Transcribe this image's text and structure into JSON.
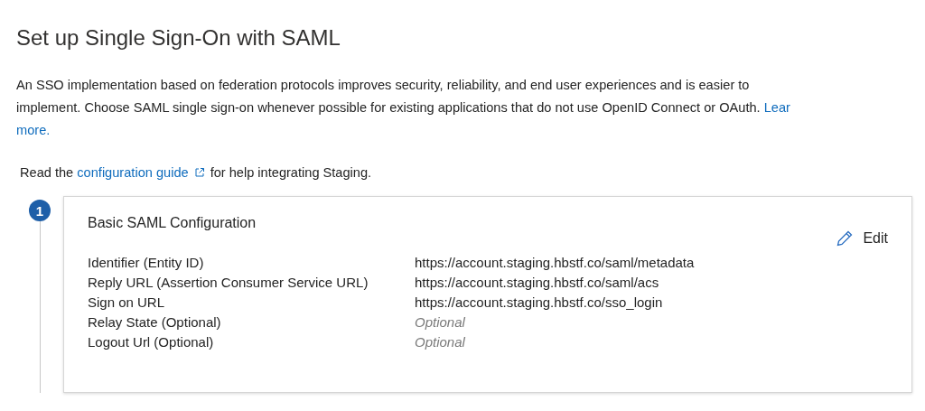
{
  "title": "Set up Single Sign-On with SAML",
  "description": {
    "lines": [
      "An SSO implementation based on federation protocols improves security, reliability, and end user experiences and is easier to",
      "implement. Choose SAML single sign-on whenever possible for existing applications that do not use OpenID Connect or OAuth."
    ],
    "link_start": "Lear",
    "link_end": "more."
  },
  "guide": {
    "before": "Read the",
    "link": "configuration guide",
    "after": "for help integrating Staging."
  },
  "steps": [
    {
      "number": "1",
      "title": "Basic SAML Configuration",
      "edit": "Edit",
      "fields": [
        {
          "label": "Identifier (Entity ID)",
          "value": "https://account.staging.hbstf.co/saml/metadata",
          "kind": "value"
        },
        {
          "label": "Reply URL (Assertion Consumer Service URL)",
          "value": "https://account.staging.hbstf.co/saml/acs",
          "kind": "value"
        },
        {
          "label": "Sign on URL",
          "value": "https://account.staging.hbstf.co/sso_login",
          "kind": "value"
        },
        {
          "label": "Relay State (Optional)",
          "value": "Optional",
          "kind": "placeholder"
        },
        {
          "label": "Logout Url (Optional)",
          "value": "Optional",
          "kind": "placeholder"
        }
      ]
    }
  ]
}
